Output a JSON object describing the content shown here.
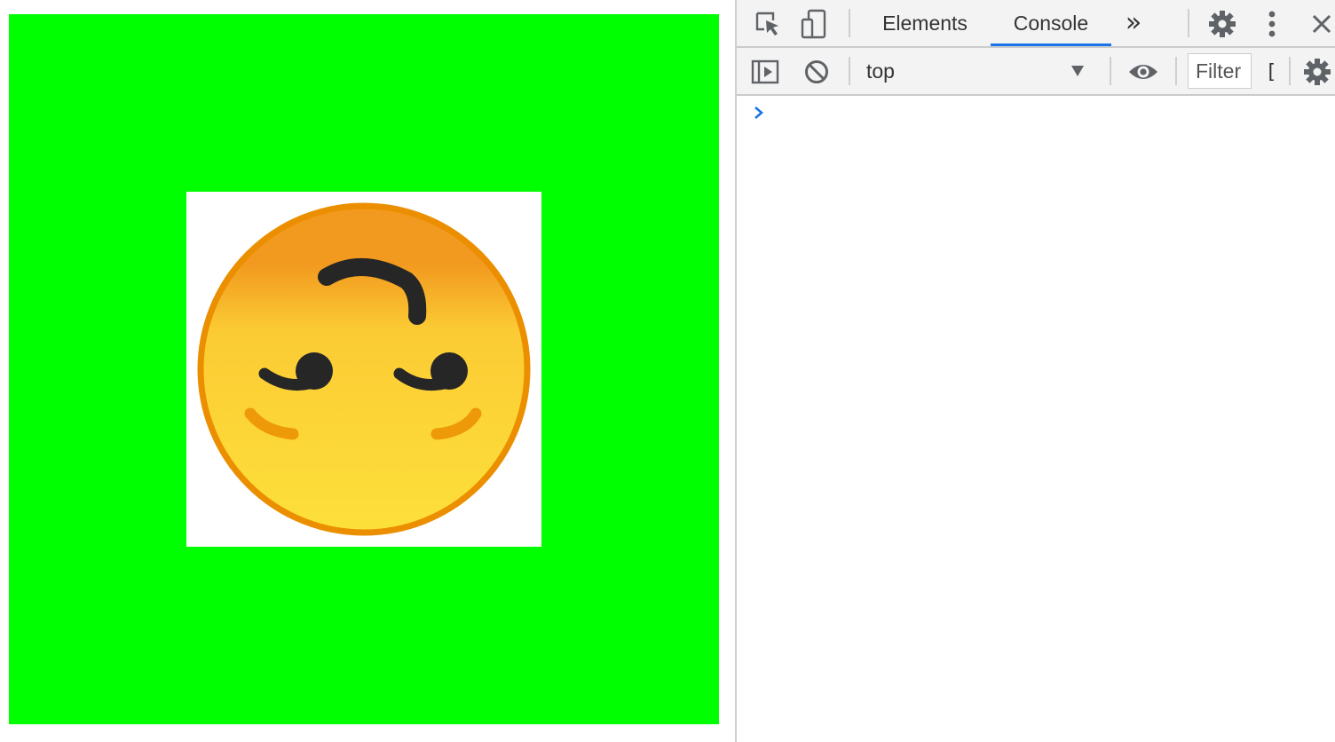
{
  "page": {
    "canvas_color": "#00ff00",
    "frame_color": "#ffffff"
  },
  "emoji": {
    "icon": "upside-down-smirk-face-emoji",
    "face_fill_top": "#f29a1f",
    "face_fill_bottom": "#fde03a",
    "outline_color": "#eb8f00",
    "feature_color": "#262626"
  },
  "devtools": {
    "toolbar": {
      "inspect_icon": "inspect-element-icon",
      "device_icon": "device-toolbar-icon",
      "tabs": [
        {
          "label": "Elements",
          "active": false
        },
        {
          "label": "Console",
          "active": true
        }
      ],
      "more_tabs_icon": "chevron-double-right-icon",
      "more_tabs_glyph": "»",
      "settings_icon": "gear-icon",
      "menu_icon": "kebab-menu-icon",
      "close_icon": "close-icon",
      "accent_color": "#1a73e8"
    },
    "console_toolbar": {
      "sidebar_icon": "show-console-sidebar-icon",
      "clear_icon": "clear-console-icon",
      "context": "top",
      "dropdown_icon": "triangle-down-icon",
      "live_expression_icon": "eye-icon",
      "filter_placeholder": "Filter",
      "levels_label_partial": "[",
      "settings_icon": "gear-icon"
    },
    "console": {
      "prompt_icon": "chevron-right-icon",
      "prompt_color": "#1a73e8"
    }
  }
}
